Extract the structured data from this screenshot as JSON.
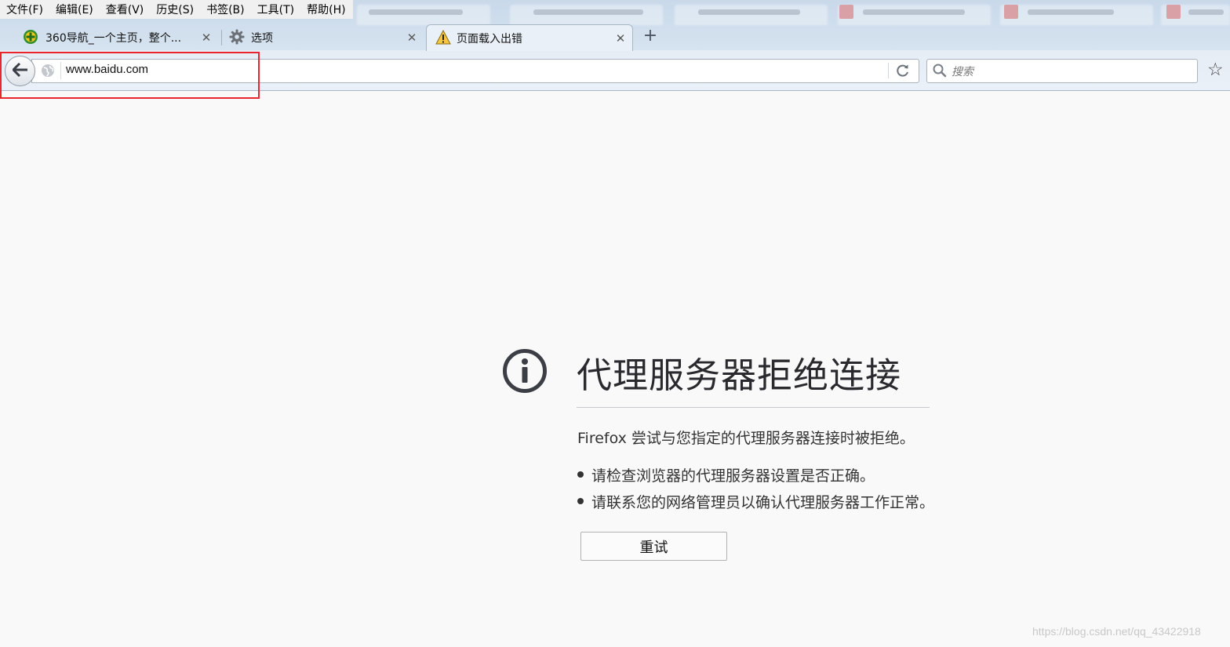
{
  "menubar": {
    "items": [
      {
        "label": "文件(F)"
      },
      {
        "label": "编辑(E)"
      },
      {
        "label": "查看(V)"
      },
      {
        "label": "历史(S)"
      },
      {
        "label": "书签(B)"
      },
      {
        "label": "工具(T)"
      },
      {
        "label": "帮助(H)"
      }
    ]
  },
  "tabs": [
    {
      "label": "360导航_一个主页，整个...",
      "icon": "360-icon",
      "active": false
    },
    {
      "label": "选项",
      "icon": "gear-icon",
      "active": false
    },
    {
      "label": "页面载入出错",
      "icon": "warning-icon",
      "active": true
    }
  ],
  "toolbar": {
    "url": "www.baidu.com",
    "search_placeholder": "搜索"
  },
  "error": {
    "title": "代理服务器拒绝连接",
    "description": "Firefox 尝试与您指定的代理服务器连接时被拒绝。",
    "bullets": [
      "请检查浏览器的代理服务器设置是否正确。",
      "请联系您的网络管理员以确认代理服务器工作正常。"
    ],
    "retry_label": "重试"
  },
  "watermark": "https://blog.csdn.net/qq_43422918",
  "colors": {
    "highlight": "#e8262b",
    "page_bg": "#f9f9fa",
    "chrome_bg": "#d6e3f0"
  }
}
